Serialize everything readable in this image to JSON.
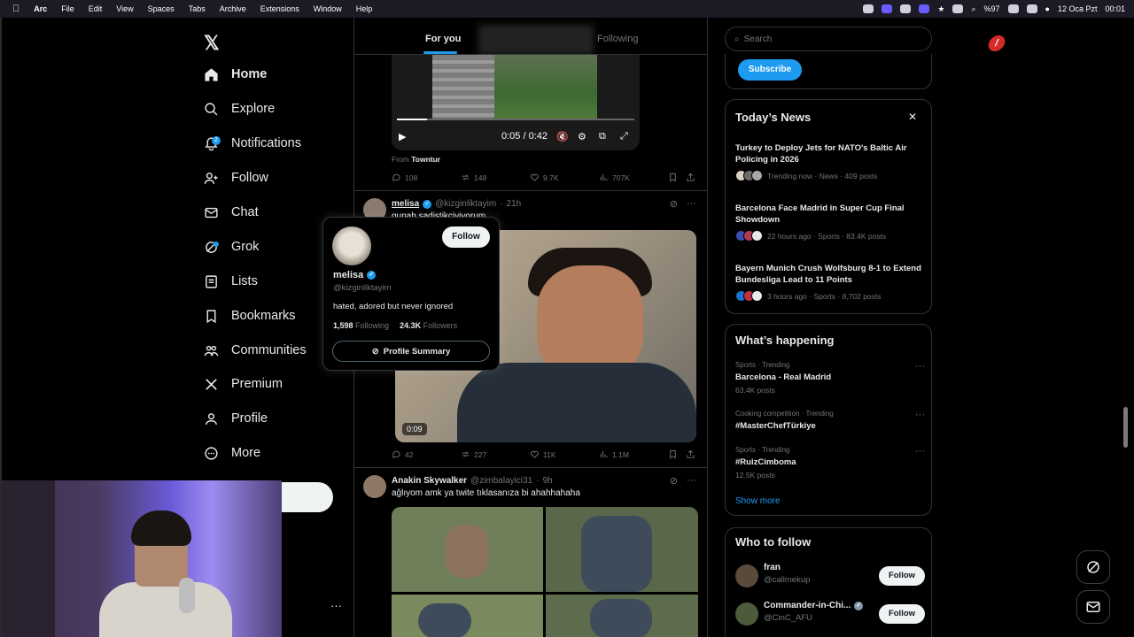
{
  "menubar": {
    "apple": "",
    "app": "Arc",
    "menus": [
      "File",
      "Edit",
      "View",
      "Spaces",
      "Tabs",
      "Archive",
      "Extensions",
      "Window",
      "Help"
    ],
    "battery": "%97",
    "date": "12 Oca Pzt",
    "time": "00:01"
  },
  "logo": "𝕏",
  "nav": [
    {
      "label": "Home",
      "icon": "home-icon"
    },
    {
      "label": "Explore",
      "icon": "search-icon"
    },
    {
      "label": "Notifications",
      "icon": "bell-icon",
      "badge": "2"
    },
    {
      "label": "Follow",
      "icon": "person-add-icon"
    },
    {
      "label": "Chat",
      "icon": "mail-icon"
    },
    {
      "label": "Grok",
      "icon": "grok-icon"
    },
    {
      "label": "Lists",
      "icon": "list-icon"
    },
    {
      "label": "Bookmarks",
      "icon": "bookmark-icon"
    },
    {
      "label": "Communities",
      "icon": "communities-icon"
    },
    {
      "label": "Premium",
      "icon": "x-icon"
    },
    {
      "label": "Profile",
      "icon": "person-icon"
    },
    {
      "label": "More",
      "icon": "more-circle-icon"
    }
  ],
  "nav_more": "···",
  "tabs": {
    "for_you": "For you",
    "following": "Following"
  },
  "post0": {
    "video_time": "0:05 / 0:42",
    "from_label": "From",
    "from_name": "Towntur",
    "replies": "108",
    "reposts": "148",
    "likes": "9.7K",
    "views": "707K"
  },
  "post1": {
    "name": "melisa",
    "handle": "@kizginliktayim",
    "dot": "·",
    "time": "21h",
    "text": "gunah sadistikciyiyorum",
    "video_duration": "0:09",
    "replies": "42",
    "reposts": "227",
    "likes": "11K",
    "views": "1.1M"
  },
  "post2": {
    "name": "Anakin Skywalker",
    "handle": "@zimbalayici31",
    "dot": "·",
    "time": "9h",
    "text": "ağlıyom amk ya twite tıklasanıza bi ahahhahaha"
  },
  "hovercard": {
    "name": "melisa",
    "handle": "@kizginliktayim",
    "follow": "Follow",
    "bio": "hated, adored but never ignored",
    "following_count": "1,598",
    "following_label": "Following",
    "followers_count": "24.3K",
    "followers_label": "Followers",
    "summary": "Profile Summary"
  },
  "search": {
    "placeholder": "Search"
  },
  "subscribe": "Subscribe",
  "todays_news": {
    "title": "Today’s News",
    "items": [
      {
        "title": "Turkey to Deploy Jets for NATO's Baltic Air Policing in 2026",
        "meta": "Trending now · News · 409 posts"
      },
      {
        "title": "Barcelona Face Madrid in Super Cup Final Showdown",
        "meta": "22 hours ago · Sports · 83.4K posts"
      },
      {
        "title": "Bayern Munich Crush Wolfsburg 8-1 to Extend Bundesliga Lead to 11 Points",
        "meta": "3 hours ago · Sports · 8,702 posts"
      }
    ]
  },
  "happening": {
    "title": "What’s happening",
    "items": [
      {
        "context": "Sports · Trending",
        "title": "Barcelona - Real Madrid",
        "count": "63.4K posts"
      },
      {
        "context": "Cooking competition · Trending",
        "title": "#MasterChefTürkiye",
        "count": ""
      },
      {
        "context": "Sports · Trending",
        "title": "#RuizCimboma",
        "count": "12.5K posts"
      }
    ],
    "show_more": "Show more"
  },
  "who_to_follow": {
    "title": "Who to follow",
    "items": [
      {
        "name": "fran",
        "handle": "@callmekup",
        "button": "Follow",
        "verified": false
      },
      {
        "name": "Commander-in-Chi...",
        "handle": "@CinC_AFU",
        "button": "Follow",
        "verified": true
      }
    ]
  },
  "colors": {
    "accent": "#1d9bf0",
    "background": "#000000",
    "border": "#2f3336",
    "muted": "#71767b"
  }
}
